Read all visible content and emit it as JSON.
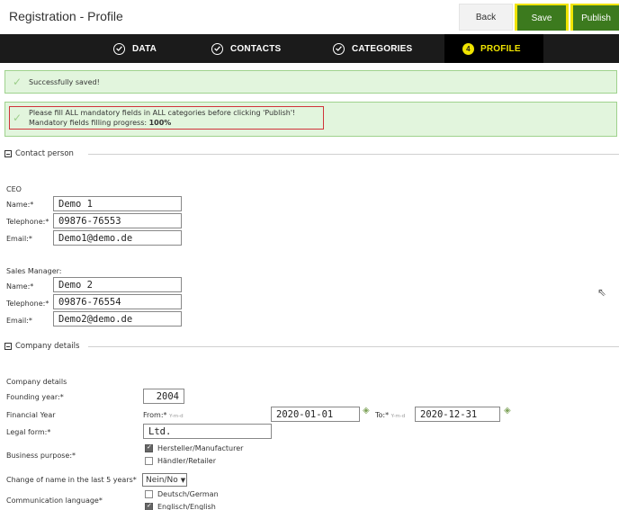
{
  "header": {
    "title": "Registration - Profile",
    "back_label": "Back",
    "save_label": "Save",
    "publish_label": "Publish"
  },
  "steps": [
    {
      "label": "DATA",
      "state": "done"
    },
    {
      "label": "CONTACTS",
      "state": "done"
    },
    {
      "label": "CATEGORIES",
      "state": "done"
    },
    {
      "label": "PROFILE",
      "state": "active",
      "number": "4"
    }
  ],
  "messages": {
    "saved": "Successfully saved!",
    "mandatory_line1": "Please fill ALL mandatory fields in ALL categories before clicking 'Publish'!",
    "mandatory_line2_prefix": "Mandatory fields filling progress: ",
    "progress_value": "100%"
  },
  "contact_person": {
    "legend": "Contact person",
    "ceo": {
      "heading": "CEO",
      "name_label": "Name:*",
      "name": "Demo 1",
      "telephone_label": "Telephone:*",
      "telephone": "09876-76553",
      "email_label": "Email:*",
      "email": "Demo1@demo.de"
    },
    "sales": {
      "heading": "Sales Manager:",
      "name_label": "Name:*",
      "name": "Demo 2",
      "telephone_label": "Telephone:*",
      "telephone": "09876-76554",
      "email_label": "Email:*",
      "email": "Demo2@demo.de"
    }
  },
  "company": {
    "legend": "Company details",
    "heading": "Company details",
    "founding_label": "Founding year:*",
    "founding_year": "2004",
    "financial_label": "Financial Year",
    "from_label": "From:*",
    "date_hint": "Y-m-d",
    "from": "2020-01-01",
    "to_label": "To:*",
    "to": "2020-12-31",
    "legal_label": "Legal form:*",
    "legal_form": "Ltd.",
    "business_label": "Business purpose:*",
    "business_options": [
      {
        "label": "Hersteller/Manufacturer",
        "checked": true
      },
      {
        "label": "Händler/Retailer",
        "checked": false
      }
    ],
    "name_change_label": "Change of name in the last 5 years*",
    "name_change_value": "Nein/No",
    "language_label": "Communication language*",
    "language_options": [
      {
        "label": "Deutsch/German",
        "checked": false
      },
      {
        "label": "Englisch/English",
        "checked": true
      }
    ]
  }
}
